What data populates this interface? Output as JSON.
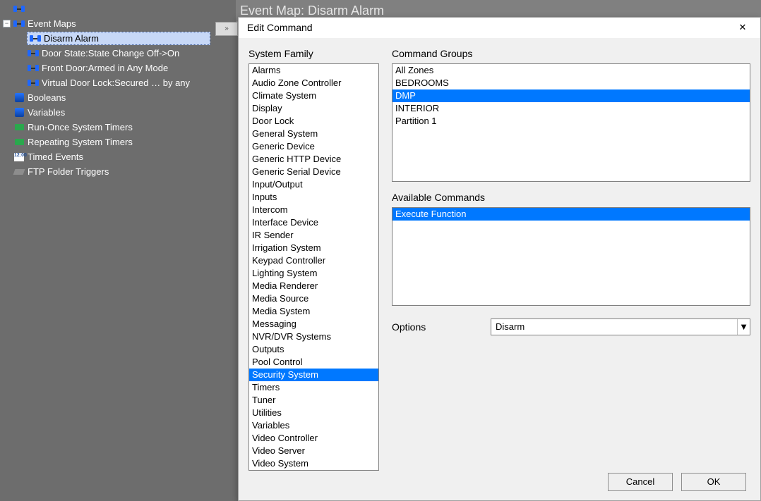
{
  "page_header": "Event Map: Disarm Alarm",
  "tree": {
    "top_row_visible_text": "",
    "items": [
      {
        "level": 0,
        "expander": "",
        "icon": "eventmap",
        "label": ""
      },
      {
        "level": 0,
        "expander": "−",
        "icon": "eventmap",
        "label": "Event Maps"
      },
      {
        "level": 1,
        "expander": "",
        "icon": "eventmap",
        "label": "Disarm Alarm",
        "selected": true
      },
      {
        "level": 1,
        "expander": "",
        "icon": "eventmap",
        "label": "Door State:State Change Off->On"
      },
      {
        "level": 1,
        "expander": "",
        "icon": "eventmap",
        "label": "Front Door:Armed in Any Mode"
      },
      {
        "level": 1,
        "expander": "",
        "icon": "eventmap",
        "label": "Virtual Door Lock:Secured … by any"
      },
      {
        "level": 0,
        "expander": "",
        "icon": "var",
        "label": "Booleans"
      },
      {
        "level": 0,
        "expander": "",
        "icon": "var",
        "label": "Variables"
      },
      {
        "level": 0,
        "expander": "",
        "icon": "timer",
        "label": "Run-Once System Timers"
      },
      {
        "level": 0,
        "expander": "",
        "icon": "timer",
        "label": "Repeating System Timers"
      },
      {
        "level": 0,
        "expander": "",
        "icon": "clock",
        "label": "Timed Events"
      },
      {
        "level": 0,
        "expander": "",
        "icon": "ftp",
        "label": "FTP Folder Triggers"
      }
    ]
  },
  "dialog": {
    "title": "Edit Command",
    "system_family_label": "System Family",
    "system_family": [
      "Alarms",
      "Audio Zone Controller",
      "Climate System",
      "Display",
      "Door Lock",
      "General System",
      "Generic Device",
      "Generic HTTP Device",
      "Generic Serial Device",
      "Input/Output",
      "Inputs",
      "Intercom",
      "Interface Device",
      "IR Sender",
      "Irrigation System",
      "Keypad Controller",
      "Lighting System",
      "Media Renderer",
      "Media Source",
      "Media System",
      "Messaging",
      "NVR/DVR Systems",
      "Outputs",
      "Pool Control",
      "Security System",
      "Timers",
      "Tuner",
      "Utilities",
      "Variables",
      "Video Controller",
      "Video Server",
      "Video System"
    ],
    "system_family_selected": "Security System",
    "command_groups_label": "Command Groups",
    "command_groups": [
      "All Zones",
      "BEDROOMS",
      "DMP",
      "INTERIOR",
      "Partition 1"
    ],
    "command_groups_selected": "DMP",
    "available_commands_label": "Available Commands",
    "available_commands": [
      "Execute Function"
    ],
    "available_commands_selected": "Execute Function",
    "options_label": "Options",
    "options_value": "Disarm",
    "buttons": {
      "cancel": "Cancel",
      "ok": "OK"
    }
  }
}
